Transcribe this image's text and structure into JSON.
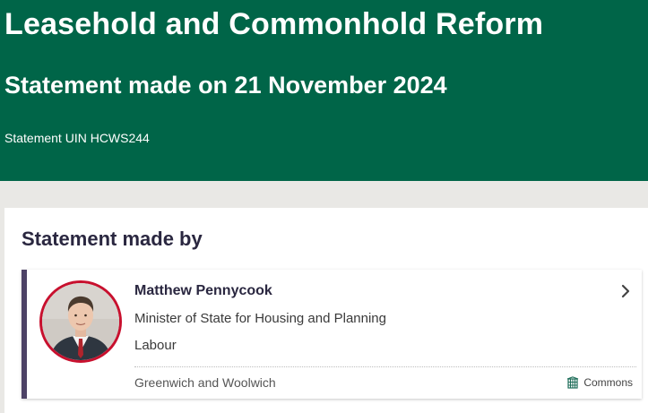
{
  "page": {
    "title": "Leasehold and Commonhold Reform",
    "subtitle": "Statement made on 21 November 2024",
    "uin_text": "Statement UIN HCWS244"
  },
  "statement_by": {
    "heading": "Statement made by",
    "member": {
      "name": "Matthew Pennycook",
      "role": "Minister of State for Housing and Planning",
      "party": "Labour",
      "constituency": "Greenwich and Woolwich",
      "house": "Commons",
      "house_icon": "portcullis-icon",
      "party_color": "#c8102e"
    }
  },
  "colors": {
    "header_bg": "#006548",
    "card_accent": "#4d4266",
    "page_bg": "#e9e8e5"
  }
}
